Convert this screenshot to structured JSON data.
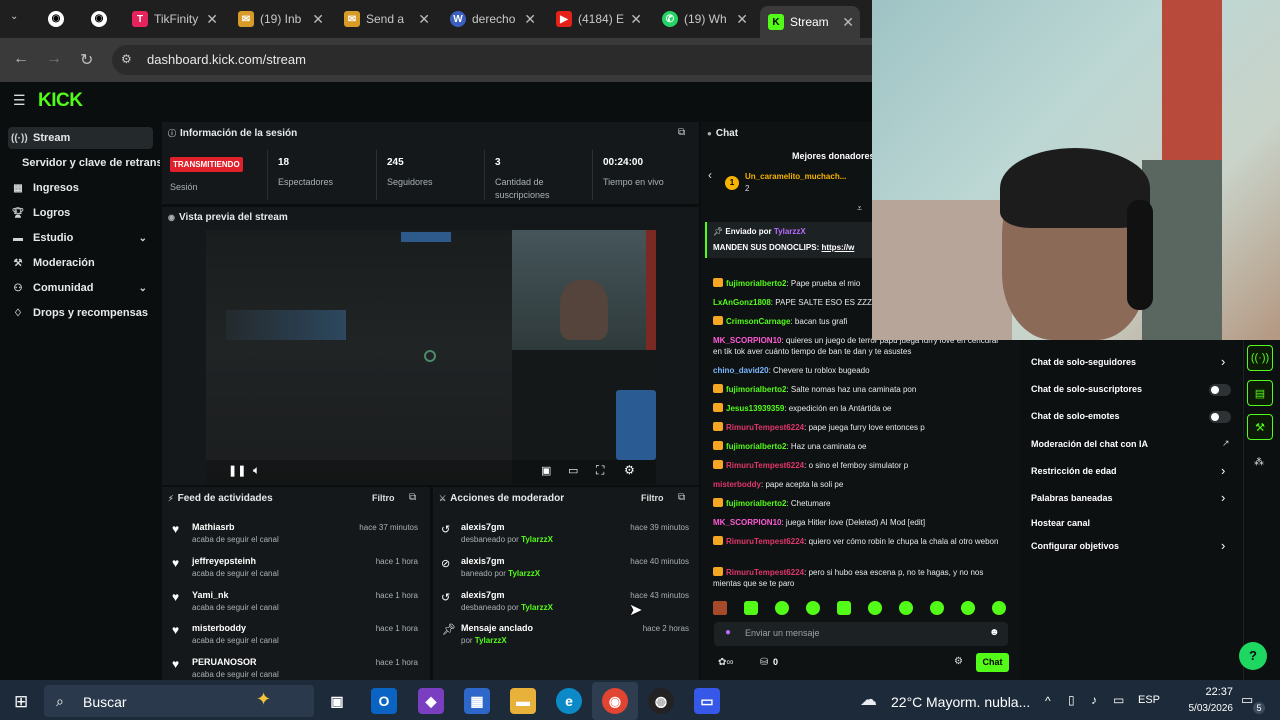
{
  "browser": {
    "tabs": [
      {
        "label": "TikFinity",
        "color": "#e6235a",
        "glyph": "T"
      },
      {
        "label": "(19) Inb",
        "color": "#d89b28",
        "glyph": "✉"
      },
      {
        "label": "Send a",
        "color": "#d89b28",
        "glyph": "✉"
      },
      {
        "label": "derecho",
        "color": "#3b5fbf",
        "glyph": "W"
      },
      {
        "label": "(4184) E",
        "color": "#e62117",
        "glyph": "▶"
      },
      {
        "label": "(19) Wh",
        "color": "#25d366",
        "glyph": "✆"
      },
      {
        "label": "Stream",
        "color": "#53fc18",
        "glyph": "K"
      }
    ],
    "url": "dashboard.kick.com/stream"
  },
  "sidebar": {
    "logo": "KICK",
    "items": [
      {
        "label": "Stream",
        "icon": "broadcast-icon"
      },
      {
        "label": "Servidor y clave de retransmisión",
        "icon": ""
      },
      {
        "label": "Ingresos",
        "icon": "chart-icon"
      },
      {
        "label": "Logros",
        "icon": "trophy-icon"
      },
      {
        "label": "Estudio",
        "icon": "studio-icon"
      },
      {
        "label": "Moderación",
        "icon": "wrench-icon"
      },
      {
        "label": "Comunidad",
        "icon": "community-icon"
      },
      {
        "label": "Drops y recompensas",
        "icon": "drops-icon"
      }
    ]
  },
  "session": {
    "title": "Información de la sesión",
    "status": "TRANSMITIENDO",
    "status_label": "Sesión",
    "stats": [
      {
        "value": "18",
        "label": "Espectadores"
      },
      {
        "value": "245",
        "label": "Seguidores"
      },
      {
        "value": "3",
        "label": "Cantidad de suscripciones"
      },
      {
        "value": "00:24:00",
        "label": "Tiempo en vivo"
      }
    ]
  },
  "preview": {
    "title": "Vista previa del stream"
  },
  "activity": {
    "title": "Feed de actividades",
    "filter": "Filtro",
    "items": [
      {
        "name": "Mathiasrb",
        "sub": "acaba de seguir el canal",
        "time": "hace 37 minutos"
      },
      {
        "name": "jeffreyepsteinh",
        "sub": "acaba de seguir el canal",
        "time": "hace 1 hora"
      },
      {
        "name": "Yami_nk",
        "sub": "acaba de seguir el canal",
        "time": "hace 1 hora"
      },
      {
        "name": "misterboddy",
        "sub": "acaba de seguir el canal",
        "time": "hace 1 hora"
      },
      {
        "name": "PERUANOSOR",
        "sub": "acaba de seguir el canal",
        "time": "hace 1 hora"
      }
    ]
  },
  "modactions": {
    "title": "Acciones de moderador",
    "filter": "Filtro",
    "items": [
      {
        "name": "alexis7gm",
        "sub": "desbaneado por",
        "by": "TylarzzX",
        "time": "hace 39 minutos"
      },
      {
        "name": "alexis7gm",
        "sub": "baneado por",
        "by": "TylarzzX",
        "time": "hace 40 minutos"
      },
      {
        "name": "alexis7gm",
        "sub": "desbaneado por",
        "by": "TylarzzX",
        "time": "hace 43 minutos"
      },
      {
        "name": "Mensaje anclado",
        "sub": "por",
        "by": "TylarzzX",
        "time": "hace 2 horas"
      }
    ]
  },
  "chat": {
    "title": "Chat",
    "top_donors": "Mejores donadores",
    "donor_name": "Un_caramelito_muchach...",
    "donor_amount": "2",
    "pinned_by_label": "Enviado por",
    "pinned_by": "TylarzzX",
    "pinned_text": "MANDEN SUS DONOCLIPS:",
    "pinned_link": "https://w",
    "messages": [
      {
        "user": "fujimorialberto2",
        "color": "#53fc18",
        "text": "Pape prueba el mio",
        "badge": true
      },
      {
        "user": "LxAnGonz1808",
        "color": "#53fc18",
        "text": "PAPE SALTE ESO ES ZZZ",
        "badge": false
      },
      {
        "user": "CrimsonCarnage",
        "color": "#53fc18",
        "text": "bacan tus grafi",
        "badge": true
      },
      {
        "user": "MK_SCORPION10",
        "color": "#ff5ad6",
        "text": "quieres un juego de terror papu juega furry love en cencurar en tik tok aver cuánto tiempo de ban te dan y te asustes",
        "badge": false
      },
      {
        "user": "chino_david20",
        "color": "#7ab7ff",
        "text": "Chevere tu roblox bugeado",
        "badge": false
      },
      {
        "user": "fujimorialberto2",
        "color": "#53fc18",
        "text": "Salte nomas haz una caminata pon",
        "badge": true
      },
      {
        "user": "Jesus13939359",
        "color": "#53fc18",
        "text": "expedición en la Antártida oe",
        "badge": true
      },
      {
        "user": "RimuruTempest6224",
        "color": "#e0366b",
        "text": "pape juega furry love entonces p",
        "badge": true
      },
      {
        "user": "fujimorialberto2",
        "color": "#53fc18",
        "text": "Haz una caminata oe",
        "badge": true
      },
      {
        "user": "RimuruTempest6224",
        "color": "#e0366b",
        "text": "o sino el femboy simulator p",
        "badge": true
      },
      {
        "user": "misterboddy",
        "color": "#e0366b",
        "text": "pape acepta la soli pe",
        "badge": false
      },
      {
        "user": "fujimorialberto2",
        "color": "#53fc18",
        "text": "Chetumare",
        "badge": true
      },
      {
        "user": "MK_SCORPION10",
        "color": "#ff5ad6",
        "text": "juega Hitler love (Deleted) AI Mod [edit]",
        "badge": false
      },
      {
        "user": "RimuruTempest6224",
        "color": "#e0366b",
        "text": "quiero ver cómo robin le chupa la chala al otro webon",
        "badge": true
      },
      {
        "user": "RimuruTempest6224",
        "color": "#e0366b",
        "text": "pero si hubo esa escena p, no te hagas, y no nos mientas que se te paro",
        "badge": true
      }
    ],
    "input_placeholder": "Enviar un mensaje",
    "send_label": "Chat",
    "counter": "0"
  },
  "settings_menu": {
    "items": [
      {
        "label": "Chat de solo-seguidores",
        "kind": "chevron"
      },
      {
        "label": "Chat de solo-suscriptores",
        "kind": "toggle"
      },
      {
        "label": "Chat de solo-emotes",
        "kind": "toggle"
      },
      {
        "label": "Moderación del chat con IA",
        "kind": "graph"
      },
      {
        "label": "Restricción de edad",
        "kind": "chevron"
      },
      {
        "label": "Palabras baneadas",
        "kind": "chevron"
      },
      {
        "label": "Hostear canal",
        "kind": "none"
      },
      {
        "label": "Configurar objetivos",
        "kind": "chevron"
      }
    ]
  },
  "taskbar": {
    "search": "Buscar",
    "temp": "22°C",
    "weather": "Mayorm. nubla...",
    "lang": "ESP",
    "time": "22:37",
    "date": "5/03/2026",
    "notif_count": "5"
  }
}
